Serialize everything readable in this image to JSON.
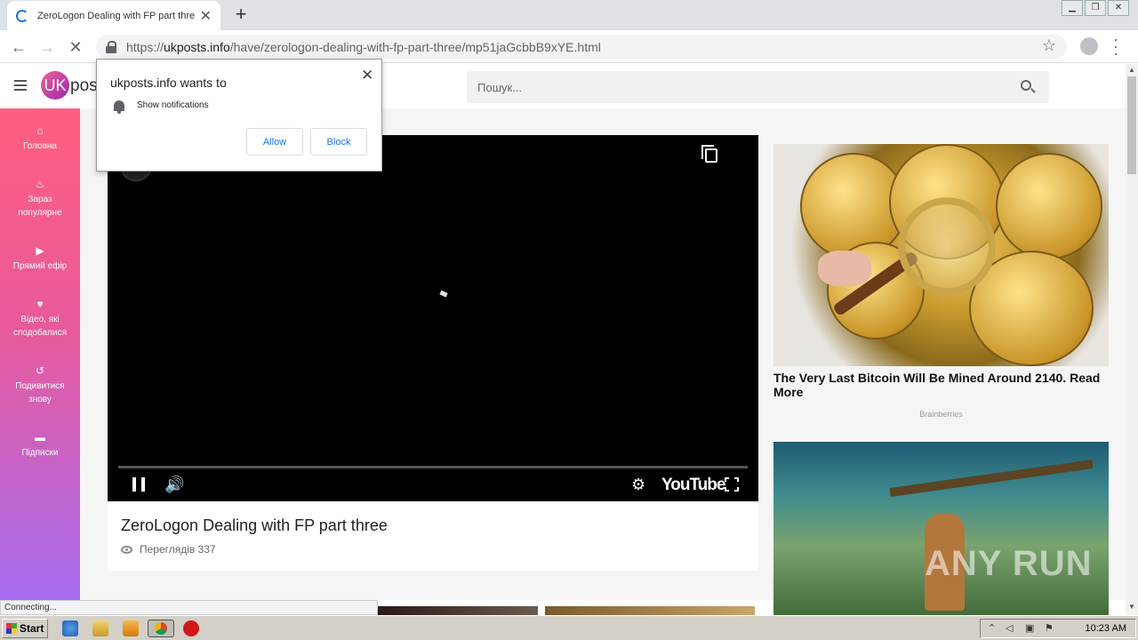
{
  "browser": {
    "tab_title": "ZeroLogon Dealing with FP part three",
    "tab_close": "✕",
    "new_tab": "+",
    "url_scheme": "https://",
    "url_host": "ukposts.info",
    "url_path": "/have/zerologon-dealing-with-fp-part-three/mp51jaGcbbB9xYE.html",
    "status_text": "Connecting..."
  },
  "site": {
    "logo_mark": "UK",
    "logo_text": "pos",
    "search_placeholder": "Пошук..."
  },
  "sidebar": {
    "items": [
      {
        "icon": "home-icon",
        "label": "Головна"
      },
      {
        "icon": "fire-icon",
        "label": "Зараз популярне"
      },
      {
        "icon": "live-icon",
        "label": "Прямий ефір"
      },
      {
        "icon": "heart-icon",
        "label": "Відео, які сподобалися"
      },
      {
        "icon": "history-icon",
        "label": "Подивитися знову"
      },
      {
        "icon": "folder-icon",
        "label": "Підписки"
      }
    ]
  },
  "video": {
    "player_brand": "YouTube",
    "title": "ZeroLogon Dealing with FP part three",
    "views": "Переглядів 337"
  },
  "ads": [
    {
      "title": "The Very Last Bitcoin Will Be Mined Around 2140. Read More",
      "source": "Brainberries"
    }
  ],
  "watermark": "ANY RUN",
  "notification": {
    "title": "ukposts.info wants to",
    "permission": "Show notifications",
    "allow": "Allow",
    "block": "Block",
    "close": "✕"
  },
  "taskbar": {
    "start": "Start",
    "clock": "10:23 AM"
  },
  "colors": {
    "sidebar_top": "#ff5e7e",
    "sidebar_bottom": "#a66cf0",
    "accent_blue": "#1a73e8"
  }
}
